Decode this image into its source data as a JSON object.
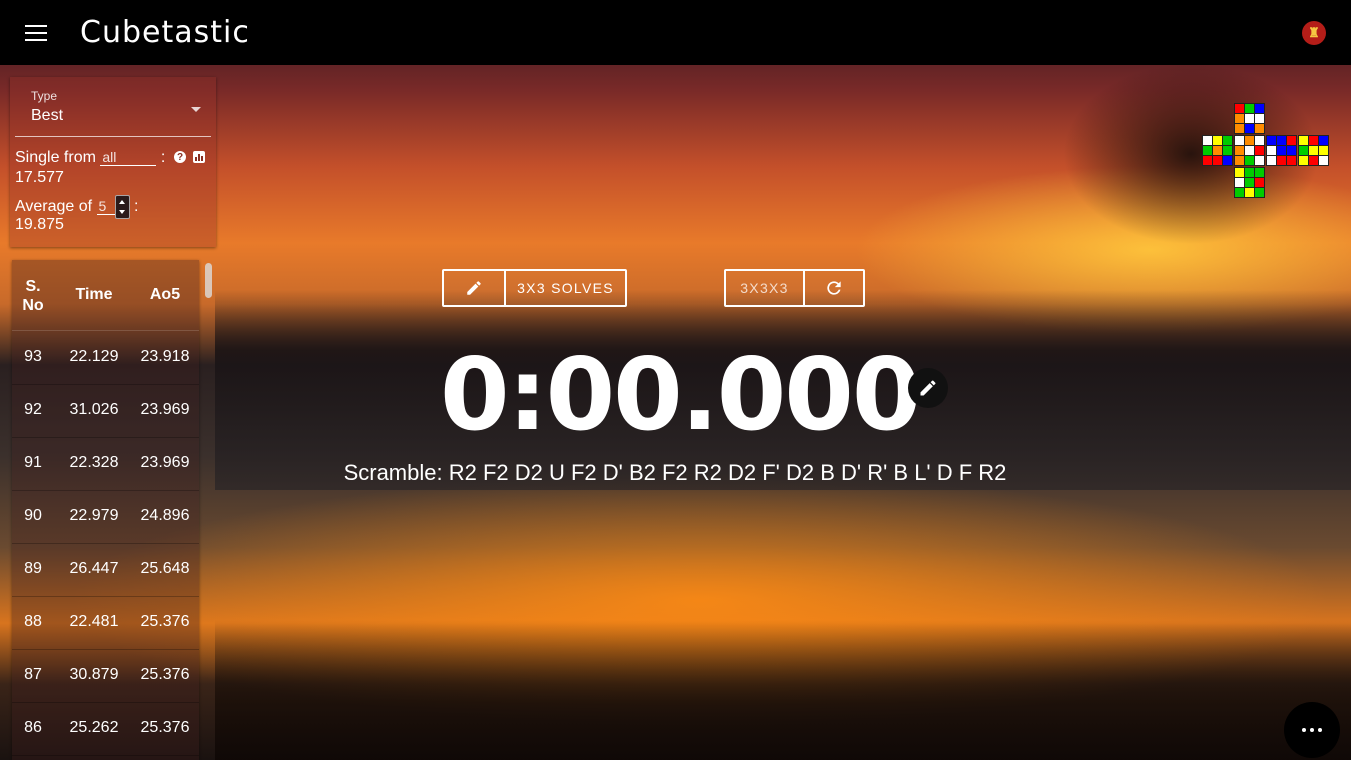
{
  "app": {
    "title": "Cubetastic",
    "avatar_glyph": "♜"
  },
  "stats_panel": {
    "type_label": "Type",
    "type_value": "Best",
    "single_prefix": "Single from",
    "single_input": "all",
    "single_suffix": ":",
    "single_value": "17.577",
    "average_prefix": "Average of",
    "average_input": "5",
    "average_suffix": ":",
    "average_value": "19.875"
  },
  "table": {
    "headers": {
      "sno": "S.\nNo",
      "time": "Time",
      "ao5": "Ao5"
    },
    "rows": [
      {
        "sno": "93",
        "time": "22.129",
        "ao5": "23.918"
      },
      {
        "sno": "92",
        "time": "31.026",
        "ao5": "23.969"
      },
      {
        "sno": "91",
        "time": "22.328",
        "ao5": "23.969"
      },
      {
        "sno": "90",
        "time": "22.979",
        "ao5": "24.896"
      },
      {
        "sno": "89",
        "time": "26.447",
        "ao5": "25.648"
      },
      {
        "sno": "88",
        "time": "22.481",
        "ao5": "25.376"
      },
      {
        "sno": "87",
        "time": "30.879",
        "ao5": "25.376"
      },
      {
        "sno": "86",
        "time": "25.262",
        "ao5": "25.376"
      }
    ]
  },
  "session": {
    "name_label": "3X3 SOLVES"
  },
  "puzzle": {
    "type_label": "3X3X3"
  },
  "timer": {
    "display": "0:00.000"
  },
  "scramble": {
    "text": "Scramble: R2 F2 D2 U F2 D' B2 F2 R2 D2 F' D2 B D' R' B L' D F R2"
  },
  "cube_net": {
    "colors": {
      "W": "#ffffff",
      "Y": "#ffff00",
      "R": "#ff0000",
      "O": "#ff8c00",
      "G": "#00cc00",
      "B": "#0000ff"
    },
    "U": [
      "R",
      "G",
      "B",
      "O",
      "W",
      "W",
      "O",
      "B",
      "O"
    ],
    "L": [
      "W",
      "Y",
      "G",
      "G",
      "O",
      "G",
      "R",
      "R",
      "B"
    ],
    "F": [
      "W",
      "O",
      "W",
      "O",
      "W",
      "R",
      "O",
      "G",
      "W"
    ],
    "R": [
      "B",
      "B",
      "R",
      "W",
      "B",
      "B",
      "W",
      "R",
      "R"
    ],
    "B": [
      "Y",
      "R",
      "B",
      "G",
      "Y",
      "Y",
      "Y",
      "R",
      "W"
    ],
    "D": [
      "Y",
      "G",
      "G",
      "W",
      "G",
      "R",
      "G",
      "Y",
      "G"
    ]
  }
}
